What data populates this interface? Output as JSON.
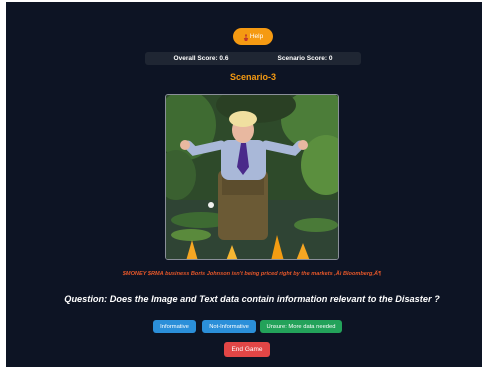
{
  "header": {
    "help_label": "Help",
    "help_icon": "wrench-icon"
  },
  "scores": {
    "overall": "Overall Score: 0.6",
    "scenario": "Scenario Score: 0"
  },
  "scenario": {
    "title": "Scenario-3"
  },
  "tweet": {
    "text": "$MONEY $RMA business Boris Johnson isn't being priced right by the markets ,Äì Bloomberg‚Ä¶"
  },
  "question": {
    "text": "Question: Does the Image and Text data contain information relevant to the Disaster ?"
  },
  "answers": {
    "informative": "Informative",
    "not_informative": "Not-Informative",
    "unsure": "Unsure: More data needed"
  },
  "footer": {
    "end_game_label": "End Game"
  },
  "colors": {
    "background": "#0d1424",
    "accent_orange": "#f59a12",
    "score_bar": "#1f2633",
    "button_blue": "#2b8fd9",
    "button_green": "#23a25a",
    "button_red": "#e24646",
    "tweet_text": "#e5572a"
  }
}
